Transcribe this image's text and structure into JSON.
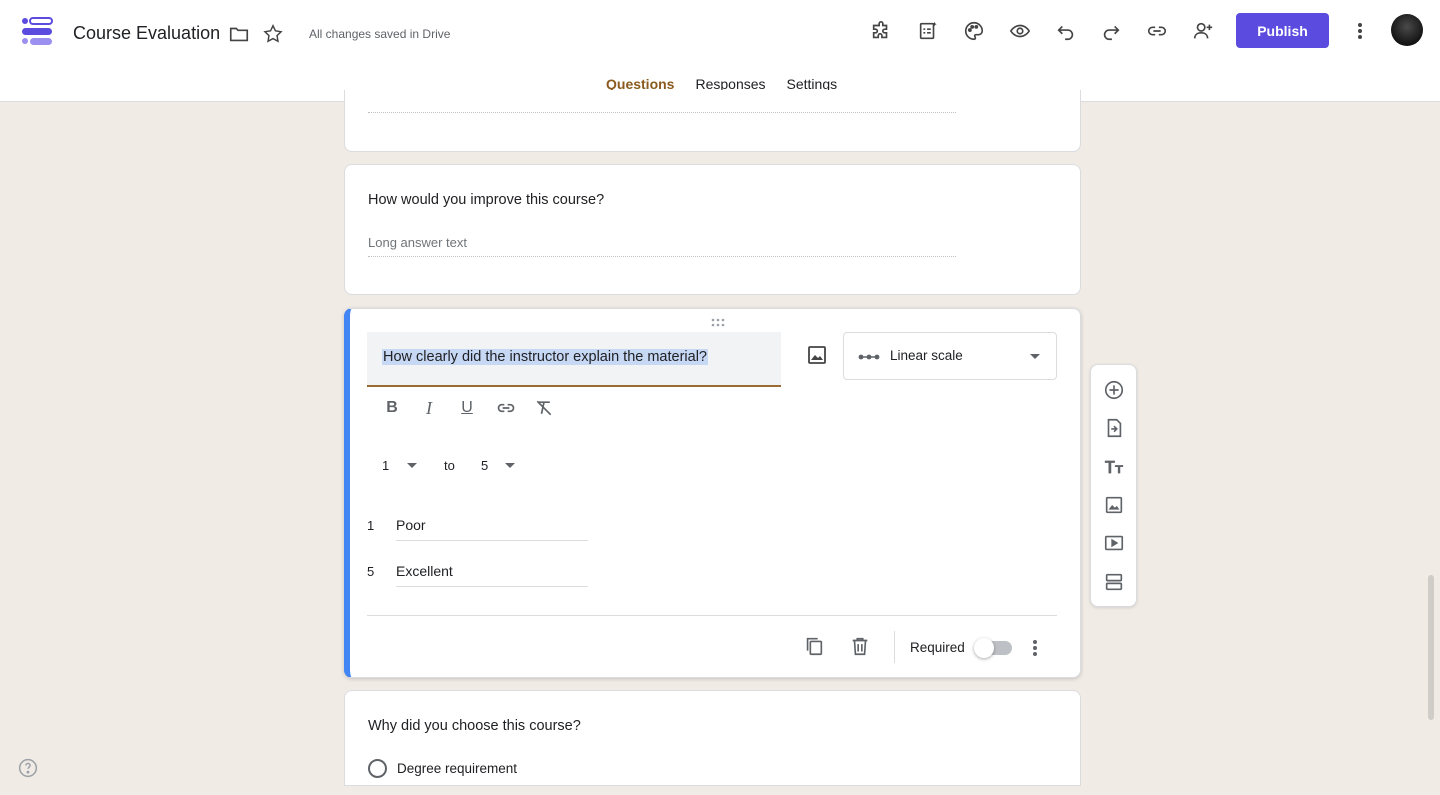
{
  "app": {
    "doc_title": "Course Evaluation",
    "saved_status": "All changes saved in Drive",
    "publish_label": "Publish",
    "accent": "#5b4bdf"
  },
  "tabs": [
    {
      "label": "Questions",
      "active": true
    },
    {
      "label": "Responses",
      "active": false
    },
    {
      "label": "Settings",
      "active": false
    }
  ],
  "toolbar_icons": [
    "addons-icon",
    "ai-form-icon",
    "palette-icon",
    "preview-icon",
    "undo-icon",
    "redo-icon",
    "link-icon",
    "add-collaborator-icon"
  ],
  "questions": {
    "q_improve": {
      "title": "How would you improve this course?",
      "hint": "Long answer text"
    },
    "q_active": {
      "title": "How clearly did the instructor explain the material?",
      "type": "Linear scale",
      "scale_min": "1",
      "scale_to": "to",
      "scale_max": "5",
      "min_num": "1",
      "min_label": "Poor",
      "max_num": "5",
      "max_label": "Excellent",
      "required_label": "Required",
      "required": false
    },
    "q_choose": {
      "title": "Why did you choose this course?",
      "option_1": "Degree requirement"
    }
  },
  "side_toolbar": [
    "add-question-icon",
    "import-questions-icon",
    "add-title-icon",
    "add-image-icon",
    "add-video-icon",
    "add-section-icon"
  ]
}
